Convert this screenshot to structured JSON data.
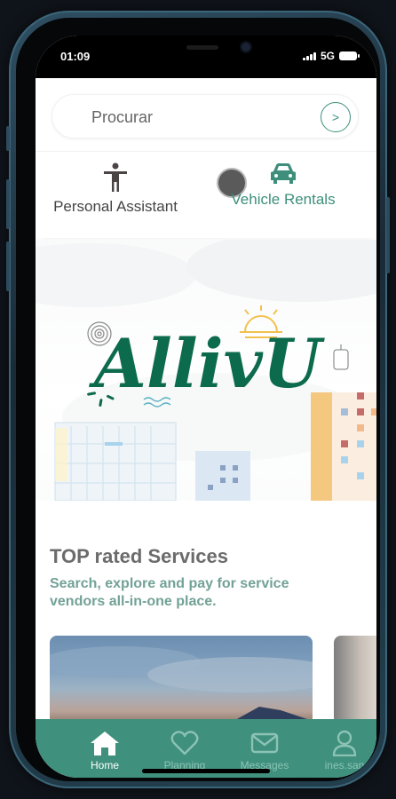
{
  "status": {
    "time": "01:09",
    "network": "5G"
  },
  "search": {
    "placeholder": "Procurar",
    "button_label": ">"
  },
  "categories": [
    {
      "label": "Personal Assistant",
      "icon": "person-icon"
    },
    {
      "label": "Vehicle Rentals",
      "icon": "car-icon"
    }
  ],
  "hero": {
    "logo_text": "AllivU"
  },
  "top_services": {
    "title": "TOP rated Services",
    "subtitle": "Search, explore and pay for service vendors all-in-one place."
  },
  "tabs": [
    {
      "label": "Home",
      "icon": "home-icon",
      "active": true
    },
    {
      "label": "Planning",
      "icon": "heart-icon",
      "active": false
    },
    {
      "label": "Messages",
      "icon": "mail-icon",
      "active": false
    },
    {
      "label": "ines.san",
      "icon": "user-icon",
      "active": false
    }
  ],
  "colors": {
    "accent": "#3f907d",
    "accent_text": "#3d8f7c",
    "logo": "#0d6b4d",
    "subtitle": "#72a296"
  }
}
